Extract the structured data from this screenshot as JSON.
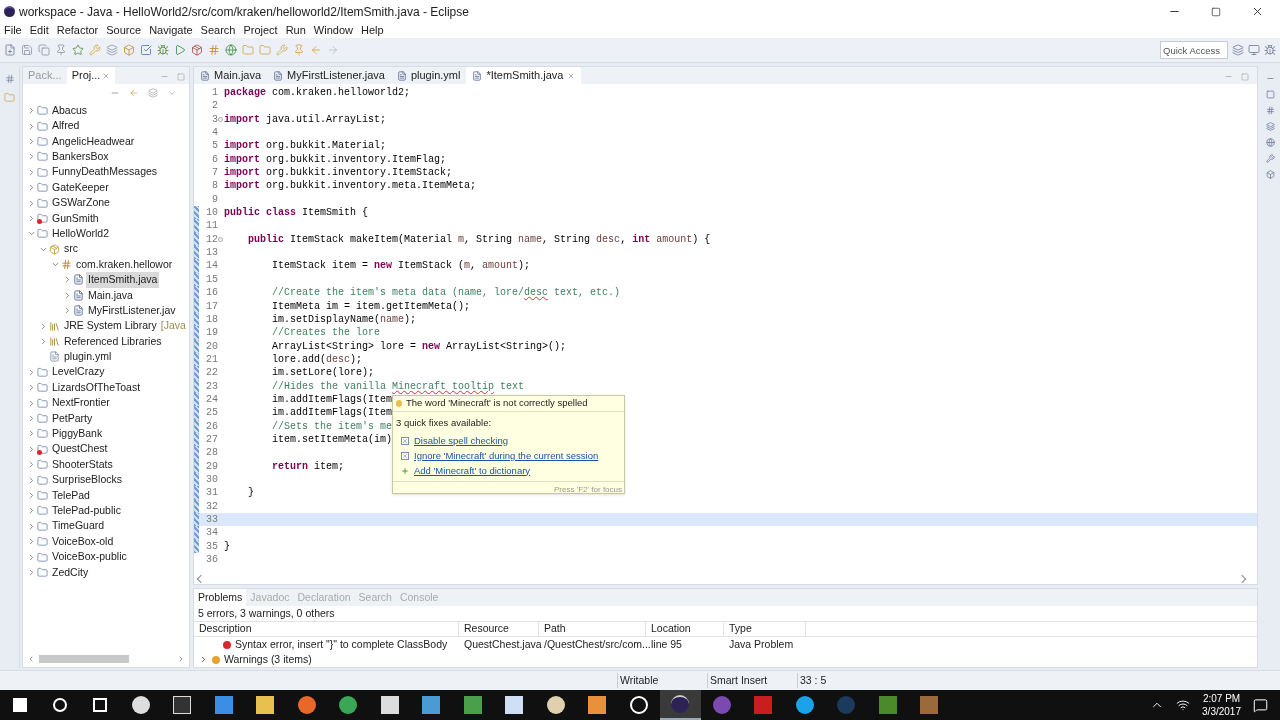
{
  "window": {
    "title": "workspace - Java - HelloWorld2/src/com/kraken/helloworld2/ItemSmith.java - Eclipse"
  },
  "menu": [
    "File",
    "Edit",
    "Refactor",
    "Source",
    "Navigate",
    "Search",
    "Project",
    "Run",
    "Window",
    "Help"
  ],
  "quick_access": {
    "placeholder": "Quick Access"
  },
  "side_view": {
    "tabs": [
      {
        "label": "Pack...",
        "selected": false
      },
      {
        "label": "Proj...",
        "selected": true
      }
    ],
    "tree": [
      {
        "label": "Abacus",
        "kind": "project",
        "expanded": false,
        "error": false
      },
      {
        "label": "Alfred",
        "kind": "project",
        "expanded": false,
        "error": false
      },
      {
        "label": "AngelicHeadwear",
        "kind": "project",
        "expanded": false,
        "error": false
      },
      {
        "label": "BankersBox",
        "kind": "project",
        "expanded": false,
        "error": false
      },
      {
        "label": "FunnyDeathMessages",
        "kind": "project",
        "expanded": false,
        "error": false
      },
      {
        "label": "GateKeeper",
        "kind": "project",
        "expanded": false,
        "error": false
      },
      {
        "label": "GSWarZone",
        "kind": "project",
        "expanded": false,
        "error": false
      },
      {
        "label": "GunSmith",
        "kind": "project",
        "expanded": false,
        "error": true
      },
      {
        "label": "HelloWorld2",
        "kind": "project",
        "expanded": true,
        "error": false,
        "children": [
          {
            "label": "src",
            "kind": "source",
            "expanded": true,
            "children": [
              {
                "label": "com.kraken.hellowor",
                "kind": "package",
                "expanded": true,
                "children": [
                  {
                    "label": "ItemSmith.java",
                    "kind": "java",
                    "expanded": false,
                    "selected": true
                  },
                  {
                    "label": "Main.java",
                    "kind": "java",
                    "expanded": false,
                    "selected": false
                  },
                  {
                    "label": "MyFirstListener.jav",
                    "kind": "java",
                    "expanded": false,
                    "selected": false
                  }
                ]
              }
            ]
          },
          {
            "label": "JRE System Library",
            "decoration": "[Java",
            "kind": "library",
            "expanded": false
          },
          {
            "label": "Referenced Libraries",
            "kind": "library",
            "expanded": false
          },
          {
            "label": "plugin.yml",
            "kind": "file"
          }
        ]
      },
      {
        "label": "LevelCrazy",
        "kind": "project",
        "expanded": false,
        "error": false
      },
      {
        "label": "LizardsOfTheToast",
        "kind": "project",
        "expanded": false,
        "error": false
      },
      {
        "label": "NextFrontier",
        "kind": "project",
        "expanded": false,
        "error": false
      },
      {
        "label": "PetParty",
        "kind": "project",
        "expanded": false,
        "error": false
      },
      {
        "label": "PiggyBank",
        "kind": "project",
        "expanded": false,
        "error": false
      },
      {
        "label": "QuestChest",
        "kind": "project",
        "expanded": false,
        "error": true
      },
      {
        "label": "ShooterStats",
        "kind": "project",
        "expanded": false,
        "error": false
      },
      {
        "label": "SurpriseBlocks",
        "kind": "project",
        "expanded": false,
        "error": false
      },
      {
        "label": "TelePad",
        "kind": "project",
        "expanded": false,
        "error": false
      },
      {
        "label": "TelePad-public",
        "kind": "project",
        "expanded": false,
        "error": false
      },
      {
        "label": "TimeGuard",
        "kind": "project",
        "expanded": false,
        "error": false
      },
      {
        "label": "VoiceBox-old",
        "kind": "project",
        "expanded": false,
        "error": false
      },
      {
        "label": "VoiceBox-public",
        "kind": "project",
        "expanded": false,
        "error": false
      },
      {
        "label": "ZedCity",
        "kind": "project",
        "expanded": false,
        "error": false
      }
    ]
  },
  "editor": {
    "tabs": [
      {
        "label": "Main.java",
        "selected": false
      },
      {
        "label": "MyFirstListener.java",
        "selected": false
      },
      {
        "label": "plugin.yml",
        "selected": false
      },
      {
        "label": "*ItemSmith.java",
        "selected": true
      }
    ],
    "lines": [
      {
        "number": "1",
        "kind": "top",
        "fold": false,
        "changed": false,
        "current": false,
        "segs": [
          {
            "kind": "kw",
            "t": "package"
          },
          {
            "kind": "plain",
            "t": " com.kraken.helloworld2;"
          }
        ]
      },
      {
        "number": "2",
        "fold": false,
        "changed": false,
        "current": false
      },
      {
        "number": "3",
        "kind": "top",
        "fold": true,
        "changed": false,
        "current": false,
        "segs": [
          {
            "kind": "kw",
            "t": "import"
          },
          {
            "kind": "plain",
            "t": " java.util.ArrayList;"
          }
        ]
      },
      {
        "number": "4",
        "fold": false,
        "changed": false,
        "current": false
      },
      {
        "number": "5",
        "kind": "top",
        "fold": false,
        "changed": false,
        "current": false,
        "segs": [
          {
            "kind": "kw",
            "t": "import"
          },
          {
            "kind": "plain",
            "t": " org.bukkit.Material;"
          }
        ]
      },
      {
        "number": "6",
        "kind": "top",
        "fold": false,
        "changed": false,
        "current": false,
        "segs": [
          {
            "kind": "kw",
            "t": "import"
          },
          {
            "kind": "plain",
            "t": " org.bukkit.inventory.ItemFlag;"
          }
        ]
      },
      {
        "number": "7",
        "kind": "top",
        "fold": false,
        "changed": false,
        "current": false,
        "segs": [
          {
            "kind": "kw",
            "t": "import"
          },
          {
            "kind": "plain",
            "t": " org.bukkit.inventory.ItemStack;"
          }
        ]
      },
      {
        "number": "8",
        "kind": "top",
        "fold": false,
        "changed": false,
        "current": false,
        "segs": [
          {
            "kind": "kw",
            "t": "import"
          },
          {
            "kind": "plain",
            "t": " org.bukkit.inventory.meta.ItemMeta;"
          }
        ]
      },
      {
        "number": "9",
        "fold": false,
        "changed": false,
        "current": false
      },
      {
        "number": "10",
        "kind": "top",
        "fold": false,
        "changed": true,
        "current": false,
        "segs": [
          {
            "kind": "kw",
            "t": "public class"
          },
          {
            "kind": "plain",
            "t": " ItemSmith {"
          }
        ]
      },
      {
        "number": "11",
        "fold": false,
        "changed": true,
        "current": false
      },
      {
        "number": "12",
        "kind": "member",
        "fold": true,
        "changed": true,
        "current": false,
        "segs": [
          {
            "kind": "kw",
            "t": "public"
          },
          {
            "kind": "plain",
            "t": " ItemStack makeItem(Material "
          },
          {
            "kind": "param",
            "t": "m"
          },
          {
            "kind": "plain",
            "t": ", String "
          },
          {
            "kind": "param",
            "t": "name"
          },
          {
            "kind": "plain",
            "t": ", String "
          },
          {
            "kind": "param",
            "t": "desc"
          },
          {
            "kind": "plain",
            "t": ", "
          },
          {
            "kind": "kw",
            "t": "int"
          },
          {
            "kind": "param",
            "t": " amount"
          },
          {
            "kind": "plain",
            "t": ") {"
          }
        ]
      },
      {
        "number": "13",
        "fold": false,
        "changed": true,
        "current": false
      },
      {
        "number": "14",
        "kind": "body",
        "fold": false,
        "changed": true,
        "current": false,
        "segs": [
          {
            "kind": "plain",
            "t": "ItemStack item = "
          },
          {
            "kind": "kw",
            "t": "new"
          },
          {
            "kind": "plain",
            "t": " ItemStack ("
          },
          {
            "kind": "param",
            "t": "m"
          },
          {
            "kind": "plain",
            "t": ", "
          },
          {
            "kind": "param",
            "t": "amount"
          },
          {
            "kind": "plain",
            "t": ");"
          }
        ]
      },
      {
        "number": "15",
        "fold": false,
        "changed": true,
        "current": false
      },
      {
        "number": "16",
        "kind": "body",
        "fold": false,
        "changed": true,
        "current": false,
        "segs": [
          {
            "kind": "comment",
            "t": "//Create the item's meta data (name, lore/"
          },
          {
            "kind": "typo",
            "t": "desc"
          },
          {
            "kind": "comment",
            "t": " text, etc.)"
          }
        ]
      },
      {
        "number": "17",
        "kind": "body",
        "fold": false,
        "changed": true,
        "current": false,
        "segs": [
          {
            "kind": "plain",
            "t": "ItemMeta im = item.getItemMeta();"
          }
        ]
      },
      {
        "number": "18",
        "kind": "body",
        "fold": false,
        "changed": true,
        "current": false,
        "segs": [
          {
            "kind": "plain",
            "t": "im.setDisplayName("
          },
          {
            "kind": "param",
            "t": "name"
          },
          {
            "kind": "plain",
            "t": ");"
          }
        ]
      },
      {
        "number": "19",
        "kind": "body",
        "fold": false,
        "changed": true,
        "current": false,
        "segs": [
          {
            "kind": "comment",
            "t": "//Creates the lore"
          }
        ]
      },
      {
        "number": "20",
        "kind": "body",
        "fold": false,
        "changed": true,
        "current": false,
        "segs": [
          {
            "kind": "plain",
            "t": "ArrayList<String> lore = "
          },
          {
            "kind": "kw",
            "t": "new"
          },
          {
            "kind": "plain",
            "t": " ArrayList<String>();"
          }
        ]
      },
      {
        "number": "21",
        "kind": "body",
        "fold": false,
        "changed": true,
        "current": false,
        "segs": [
          {
            "kind": "plain",
            "t": "lore.add("
          },
          {
            "kind": "param",
            "t": "desc"
          },
          {
            "kind": "plain",
            "t": ");"
          }
        ]
      },
      {
        "number": "22",
        "kind": "body",
        "fold": false,
        "changed": true,
        "current": false,
        "segs": [
          {
            "kind": "plain",
            "t": "im.setLore(lore);"
          }
        ]
      },
      {
        "number": "23",
        "kind": "body",
        "fold": false,
        "changed": true,
        "current": false,
        "segs": [
          {
            "kind": "comment",
            "t": "//Hides the vanilla "
          },
          {
            "kind": "typo",
            "t": "Minecraft tooltip"
          },
          {
            "kind": "comment",
            "t": " text"
          }
        ]
      },
      {
        "number": "24",
        "kind": "body",
        "fold": false,
        "changed": true,
        "current": false,
        "segs": [
          {
            "kind": "plain",
            "t": "im.addItemFlags(Item"
          }
        ]
      },
      {
        "number": "25",
        "kind": "body",
        "fold": false,
        "changed": true,
        "current": false,
        "segs": [
          {
            "kind": "plain",
            "t": "im.addItemFlags(Item"
          }
        ]
      },
      {
        "number": "26",
        "kind": "body",
        "fold": false,
        "changed": true,
        "current": false,
        "segs": [
          {
            "kind": "comment",
            "t": "//Sets the item's me"
          }
        ]
      },
      {
        "number": "27",
        "kind": "body",
        "fold": false,
        "changed": true,
        "current": false,
        "segs": [
          {
            "kind": "plain",
            "t": "item.setItemMeta(im)"
          }
        ]
      },
      {
        "number": "28",
        "fold": false,
        "changed": true,
        "current": false
      },
      {
        "number": "29",
        "kind": "body",
        "fold": false,
        "changed": true,
        "current": false,
        "segs": [
          {
            "kind": "kw",
            "t": "return"
          },
          {
            "kind": "plain",
            "t": " item;"
          }
        ]
      },
      {
        "number": "30",
        "fold": false,
        "changed": true,
        "current": false
      },
      {
        "number": "31",
        "kind": "member",
        "fold": false,
        "changed": true,
        "current": false,
        "segs": [
          {
            "kind": "plain",
            "t": "}"
          }
        ]
      },
      {
        "number": "32",
        "fold": false,
        "changed": true,
        "current": false
      },
      {
        "number": "33",
        "fold": false,
        "changed": true,
        "current": true
      },
      {
        "number": "34",
        "fold": false,
        "changed": true,
        "current": false
      },
      {
        "number": "35",
        "kind": "top",
        "fold": false,
        "changed": true,
        "current": false,
        "segs": [
          {
            "kind": "plain",
            "t": "}"
          }
        ]
      },
      {
        "number": "36",
        "fold": false,
        "changed": false,
        "current": false
      }
    ],
    "hover": {
      "title": "The word 'Minecraft' is not correctly spelled",
      "subtitle": "3 quick fixes available:",
      "fixes": [
        {
          "label": "Disable spell checking",
          "kind": "remove"
        },
        {
          "label": "Ignore 'Minecraft' during the current session",
          "kind": "remove"
        },
        {
          "label": "Add 'Minecraft' to dictionary",
          "kind": "add"
        }
      ],
      "footer": "Press 'F2' for focus"
    }
  },
  "bottom_panel": {
    "tabs": [
      {
        "label": "Problems",
        "selected": true
      },
      {
        "label": "Javadoc",
        "selected": false
      },
      {
        "label": "Declaration",
        "selected": false
      },
      {
        "label": "Search",
        "selected": false
      },
      {
        "label": "Console",
        "selected": false
      }
    ],
    "summary": "5 errors, 3 warnings, 0 others",
    "columns": [
      "Description",
      "Resource",
      "Path",
      "Location",
      "Type"
    ],
    "rows": [
      {
        "kind": "error",
        "cells": [
          "Syntax error, insert \"}\" to complete ClassBody",
          "QuestChest.java",
          "/QuestChest/src/com...",
          "line 95",
          "Java Problem"
        ]
      },
      {
        "kind": "group",
        "expanded": false,
        "cells": [
          "Warnings (3 items)"
        ]
      }
    ]
  },
  "status_bar": [
    "Writable",
    "Smart Insert",
    "33 : 5"
  ],
  "taskbar": {
    "time": "2:07 PM",
    "date": "3/3/2017"
  }
}
